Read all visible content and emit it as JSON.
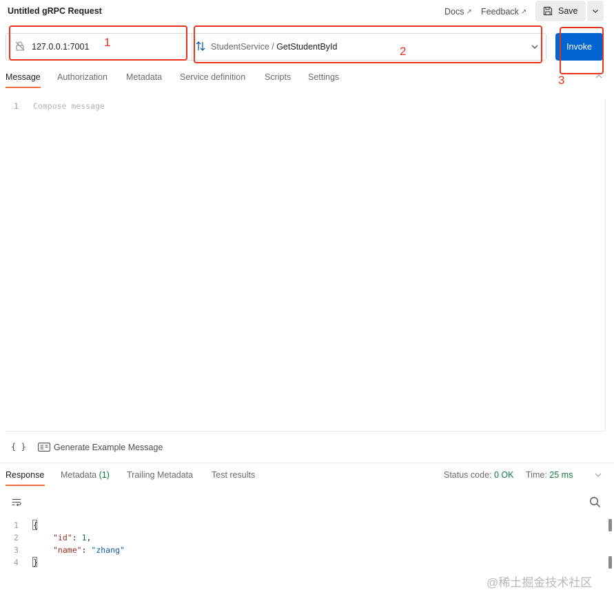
{
  "header": {
    "title": "Untitled gRPC Request",
    "docs_label": "Docs",
    "feedback_label": "Feedback",
    "external_glyph": "↗",
    "save_label": "Save"
  },
  "request": {
    "url": "127.0.0.1:7001",
    "service": "StudentService",
    "separator": " / ",
    "method": "GetStudentById",
    "invoke_label": "Invoke"
  },
  "annotations": [
    "1",
    "2",
    "3"
  ],
  "request_tabs": [
    {
      "label": "Message",
      "active": true
    },
    {
      "label": "Authorization"
    },
    {
      "label": "Metadata"
    },
    {
      "label": "Service definition"
    },
    {
      "label": "Scripts"
    },
    {
      "label": "Settings"
    }
  ],
  "editor": {
    "line_number": "1",
    "placeholder": "Compose message"
  },
  "editor_toolbar": {
    "braces_label": "{ }",
    "generate_label": "Generate Example Message"
  },
  "response_tabs": [
    {
      "label": "Response",
      "active": true
    },
    {
      "label": "Metadata",
      "count": "(1)"
    },
    {
      "label": "Trailing Metadata"
    },
    {
      "label": "Test results"
    }
  ],
  "response_status": {
    "status_label": "Status code:",
    "status_value": "0 OK",
    "time_label": "Time:",
    "time_value": "25 ms"
  },
  "response_body": {
    "line_numbers": [
      "1",
      "2",
      "3",
      "4"
    ],
    "open_brace": "{",
    "close_brace": "}",
    "key_id": "\"id\"",
    "colon": ": ",
    "value_id": "1",
    "comma": ",",
    "key_name": "\"name\"",
    "value_name": "\"zhang\""
  },
  "watermark": "@稀土掘金技术社区",
  "colors": {
    "accent_orange": "#ff6c37",
    "invoke_blue": "#0265d2",
    "annotation_red": "#e8321e",
    "status_green": "#0d7a3e"
  },
  "icons": {
    "url_icon": "lock-slash-icon",
    "method_icon": "bidirectional-arrows-icon",
    "save_icon": "save-disk-icon",
    "wrap_icon": "text-wrap-icon",
    "search_icon": "search-icon",
    "generate_icon": "example-message-icon"
  }
}
